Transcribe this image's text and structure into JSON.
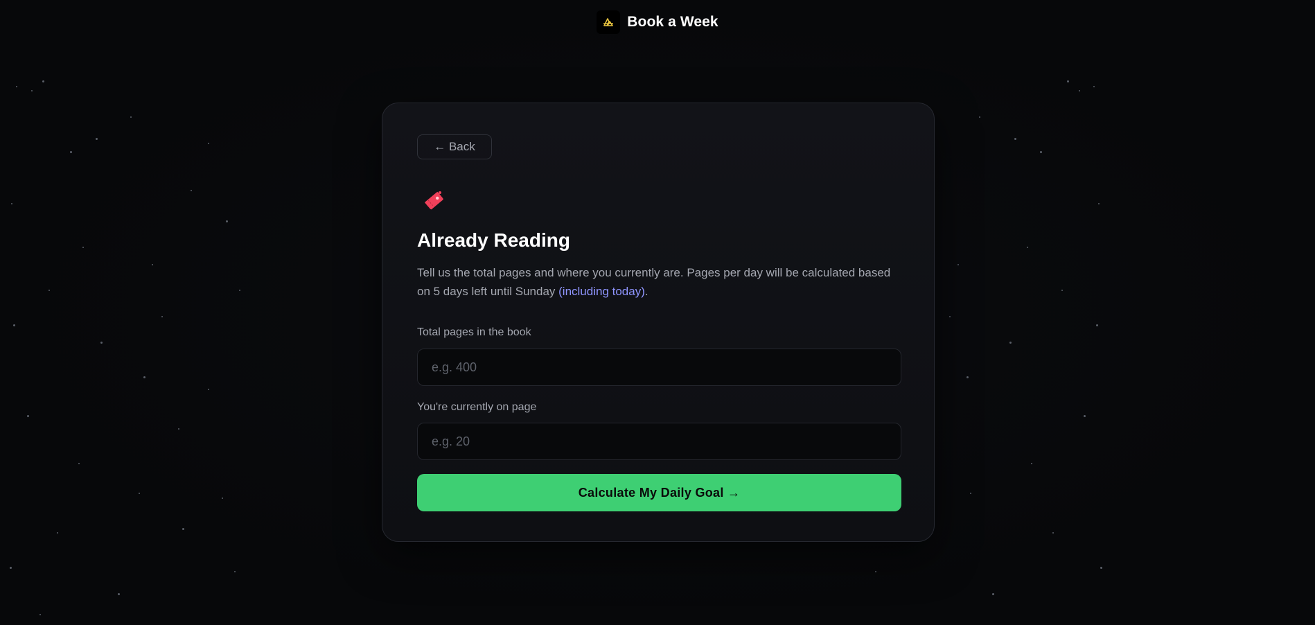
{
  "header": {
    "logo_icon": "book-a-week-logo-icon",
    "app_name": "Book a Week"
  },
  "card": {
    "back_label": "← Back",
    "hero_icon": "ticket-icon",
    "title": "Already Reading",
    "description_main": "Tell us the total pages and where you currently are. Pages per day will be calculated based on 5 days left until Sunday ",
    "description_highlight": "(including today)",
    "description_end": ".",
    "fields": [
      {
        "label": "Total pages in the book",
        "placeholder": "e.g. 400",
        "value": ""
      },
      {
        "label": "You're currently on page",
        "placeholder": "e.g. 20",
        "value": ""
      }
    ],
    "submit_label": "Calculate My Daily Goal →"
  },
  "colors": {
    "background": "#08090b",
    "card": "#121318",
    "accent_green": "#3ecf73",
    "highlight_blue": "#8f95ff",
    "icon_red": "#f0405a",
    "logo_yellow": "#e8c440"
  }
}
